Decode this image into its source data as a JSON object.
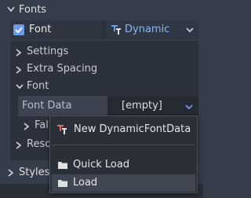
{
  "header": {
    "title": "Fonts"
  },
  "font_property": {
    "label": "Font",
    "checked": true,
    "value_label": "Dynamic",
    "value_icon": "dynamic-font-icon"
  },
  "inner": {
    "items": [
      {
        "label": "Settings",
        "expanded": false
      },
      {
        "label": "Extra Spacing",
        "expanded": false
      },
      {
        "label": "Font",
        "expanded": true
      },
      {
        "label": "Fall",
        "expanded": false
      },
      {
        "label": "Reso",
        "expanded": false
      }
    ],
    "font_data": {
      "label": "Font Data",
      "value": "[empty]"
    }
  },
  "styles": {
    "label": "Styles"
  },
  "menu": {
    "items": [
      {
        "label": "New DynamicFontData",
        "icon": "dynamic-font-data-icon"
      },
      {
        "label": "Quick Load",
        "icon": "folder-icon"
      },
      {
        "label": "Load",
        "icon": "folder-icon"
      }
    ]
  },
  "colors": {
    "background": "#363d4a",
    "accent": "#6a9ae8",
    "dynamic_text": "#8eb6f0"
  }
}
